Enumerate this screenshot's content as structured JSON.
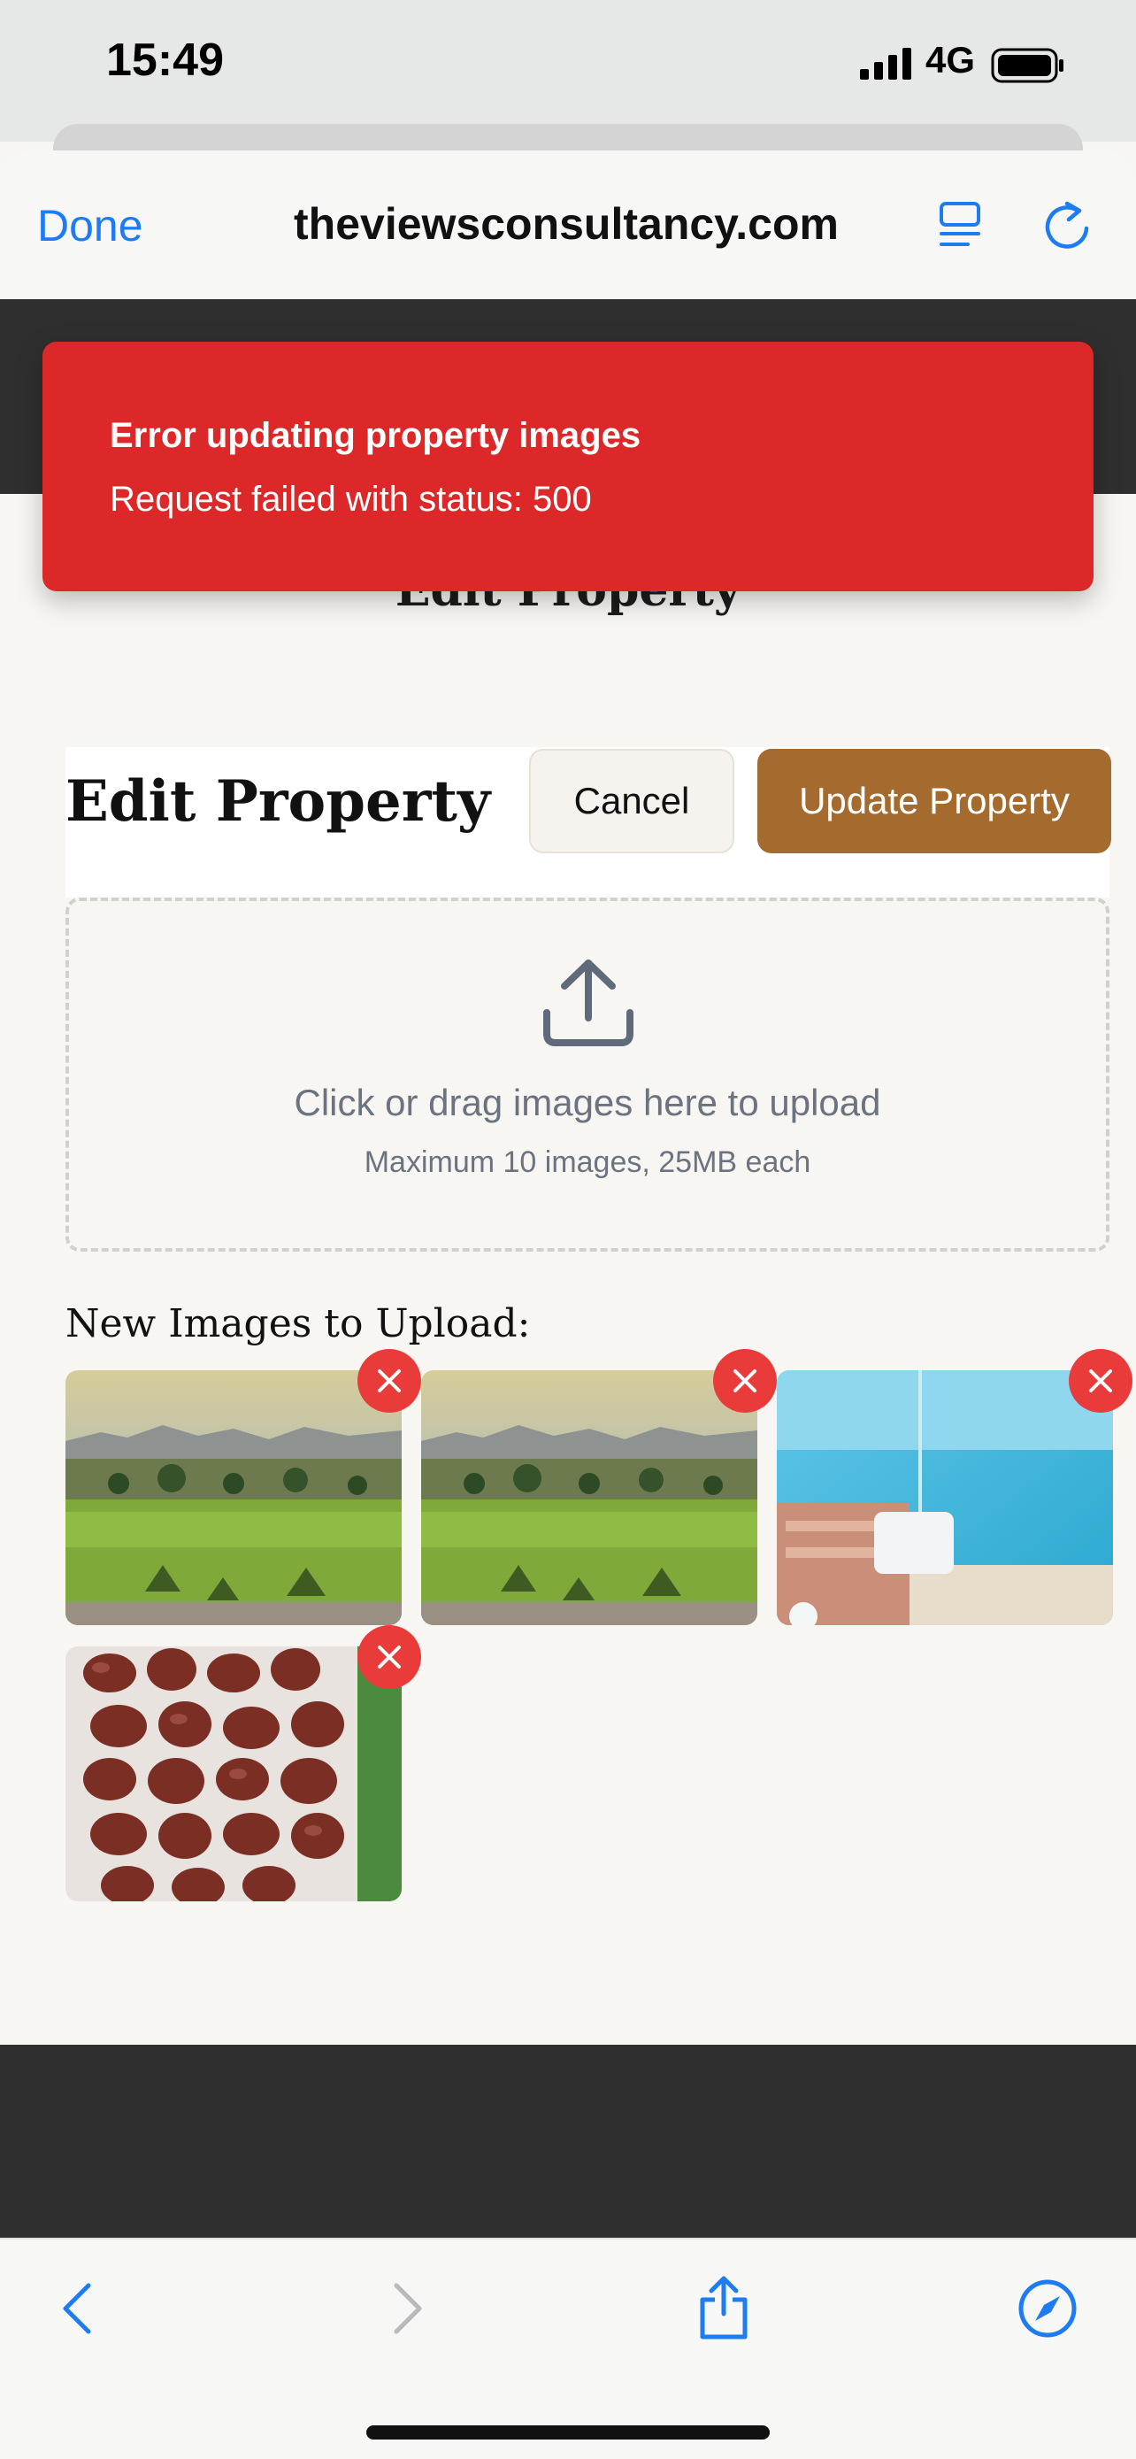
{
  "status_bar": {
    "time": "15:49",
    "network": "4G"
  },
  "browser": {
    "done_label": "Done",
    "url": "theviewsconsultancy.com"
  },
  "toast": {
    "title": "Error updating property images",
    "message": "Request failed with status: 500",
    "color": "#dc2828"
  },
  "page": {
    "behind_title": "Edit Property",
    "form_title": "Edit Property",
    "cancel_label": "Cancel",
    "update_label": "Update Property",
    "accent_color": "#a46a2e"
  },
  "dropzone": {
    "text": "Click or drag images here to upload",
    "subtext": "Maximum 10 images, 25MB each"
  },
  "new_images": {
    "label": "New Images to Upload:",
    "items": [
      {
        "subject": "golf course landscape"
      },
      {
        "subject": "golf course landscape"
      },
      {
        "subject": "beach lounge chair"
      },
      {
        "subject": "dates"
      }
    ]
  },
  "toolbar": {
    "icons": [
      "back-icon",
      "forward-icon",
      "share-icon",
      "compass-icon"
    ]
  }
}
